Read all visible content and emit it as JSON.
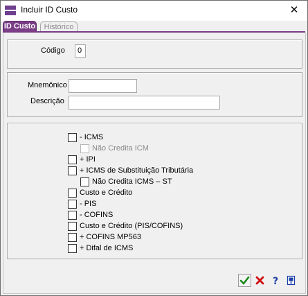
{
  "window": {
    "title": "Incluir ID Custo",
    "close_glyph": "✕"
  },
  "tabs": [
    {
      "label": "ID Custo",
      "active": true
    },
    {
      "label": "Histórico",
      "active": false
    }
  ],
  "fields": {
    "codigo_label": "Código",
    "codigo_value": "0",
    "mnemonico_label": "Mnemônico",
    "mnemonico_value": "",
    "descricao_label": "Descrição",
    "descricao_value": ""
  },
  "checkboxes": [
    {
      "label": "- ICMS",
      "checked": false,
      "enabled": true
    },
    {
      "label": "Não Credita ICM",
      "checked": false,
      "enabled": false
    },
    {
      "label": "+ IPI",
      "checked": false,
      "enabled": true
    },
    {
      "label": "+ ICMS de Substituição Tributária",
      "checked": false,
      "enabled": true
    },
    {
      "label": "Não Credita ICMS – ST",
      "checked": false,
      "enabled": true
    },
    {
      "label": "Custo e Crédito",
      "checked": false,
      "enabled": true
    },
    {
      "label": "- PIS",
      "checked": false,
      "enabled": true
    },
    {
      "label": "- COFINS",
      "checked": false,
      "enabled": true
    },
    {
      "label": "Custo e Crédito (PIS/COFINS)",
      "checked": false,
      "enabled": true
    },
    {
      "label": "+ COFINS MP563",
      "checked": false,
      "enabled": true
    },
    {
      "label": "+ Difal de ICMS",
      "checked": false,
      "enabled": true
    }
  ],
  "toolbar": {
    "confirm_icon": "check-icon",
    "cancel_icon": "x-icon",
    "help_icon": "question-icon",
    "exit_icon": "exit-door-icon",
    "colors": {
      "confirm": "#1a8a1a",
      "cancel": "#d01010",
      "help": "#1c3fa8",
      "accent": "#7a3d86"
    }
  }
}
